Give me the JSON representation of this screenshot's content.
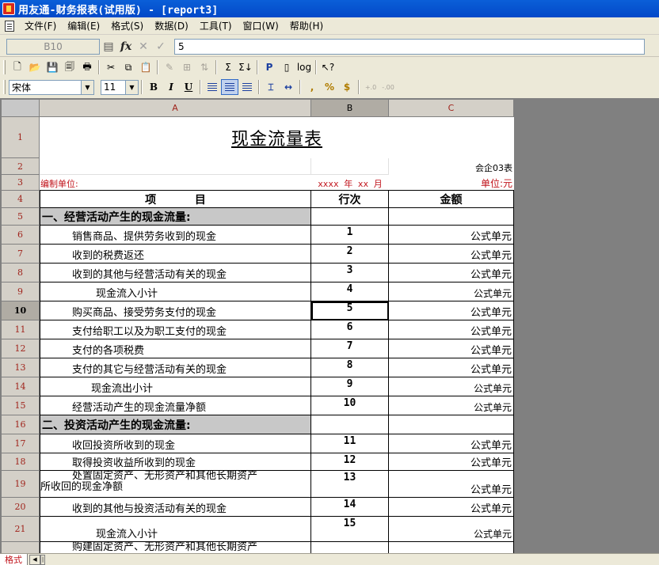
{
  "window": {
    "title": "用友通-财务报表(试用版) - [report3]"
  },
  "menu": [
    {
      "label": "文件(F)"
    },
    {
      "label": "编辑(E)"
    },
    {
      "label": "格式(S)"
    },
    {
      "label": "数据(D)"
    },
    {
      "label": "工具(T)"
    },
    {
      "label": "窗口(W)"
    },
    {
      "label": "帮助(H)"
    }
  ],
  "formula_bar": {
    "cell_ref": "B10",
    "fx": "fx",
    "value": "5"
  },
  "toolbar2": {
    "font": "宋体",
    "font_size": "11",
    "bold": "B",
    "italic": "I",
    "underline": "U"
  },
  "columns": [
    "A",
    "B",
    "C"
  ],
  "rows": [
    "1",
    "2",
    "3",
    "4",
    "5",
    "6",
    "7",
    "8",
    "9",
    "10",
    "11",
    "12",
    "13",
    "14",
    "15",
    "16",
    "17",
    "18",
    "19",
    "20",
    "21"
  ],
  "report": {
    "title": "现金流量表",
    "form_code": "会企03表",
    "unit_label": "编制单位:",
    "period": "xxxx 年 xx 月",
    "currency_unit": "单位:元",
    "header_item": "项          目",
    "header_line": "行次",
    "header_amount": "金额",
    "rows": [
      {
        "type": "section",
        "label": "一、经营活动产生的现金流量:"
      },
      {
        "type": "item",
        "label": "销售商品、提供劳务收到的现金",
        "line": "1",
        "amount": "公式单元"
      },
      {
        "type": "item",
        "label": "收到的税费返还",
        "line": "2",
        "amount": "公式单元"
      },
      {
        "type": "item",
        "label": "收到的其他与经营活动有关的现金",
        "line": "3",
        "amount": "公式单元"
      },
      {
        "type": "subtotal",
        "label": "现金流入小计",
        "line": "4",
        "amount": "公式单元"
      },
      {
        "type": "item",
        "label": "购买商品、接受劳务支付的现金",
        "line": "5",
        "amount": "公式单元"
      },
      {
        "type": "item",
        "label": "支付给职工以及为职工支付的现金",
        "line": "6",
        "amount": "公式单元"
      },
      {
        "type": "item",
        "label": "支付的各项税费",
        "line": "7",
        "amount": "公式单元"
      },
      {
        "type": "item",
        "label": "支付的其它与经营活动有关的现金",
        "line": "8",
        "amount": "公式单元"
      },
      {
        "type": "subtotal2",
        "label": "现金流出小计",
        "line": "9",
        "amount": "公式单元"
      },
      {
        "type": "item",
        "label": "经营活动产生的现金流量净额",
        "line": "10",
        "amount": "公式单元"
      },
      {
        "type": "section",
        "label": "二、投资活动产生的现金流量:"
      },
      {
        "type": "item",
        "label": "收回投资所收到的现金",
        "line": "11",
        "amount": "公式单元"
      },
      {
        "type": "item",
        "label": "取得投资收益所收到的现金",
        "line": "12",
        "amount": "公式单元"
      },
      {
        "type": "item2",
        "label_line1": "处置固定资产、无形资产和其他长期资产",
        "label_line2": "所收回的现金净额",
        "line": "13",
        "amount": "公式单元"
      },
      {
        "type": "item",
        "label": "收到的其他与投资活动有关的现金",
        "line": "14",
        "amount": "公式单元"
      },
      {
        "type": "subtotal",
        "label": "现金流入小计",
        "line": "15",
        "amount": "公式单元"
      },
      {
        "type": "item",
        "label": "购建固定资产、无形资产和其他长期资产",
        "line": "",
        "amount": ""
      }
    ]
  },
  "status": {
    "sheet_tab": "格式"
  }
}
